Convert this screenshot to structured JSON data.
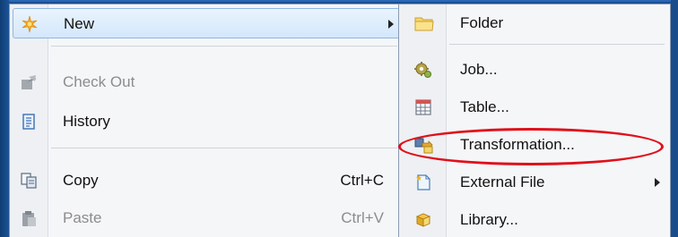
{
  "context_menu": {
    "items": [
      {
        "label": "New",
        "icon": "new-sparkle-icon",
        "submenu": true,
        "highlighted": true
      },
      {
        "label": "Check Out",
        "icon": "check-out-icon",
        "disabled": true
      },
      {
        "label": "History",
        "icon": "history-icon"
      },
      {
        "label": "Copy",
        "icon": "copy-icon",
        "shortcut": "Ctrl+C"
      },
      {
        "label": "Paste",
        "icon": "paste-icon",
        "shortcut": "Ctrl+V",
        "disabled": true
      }
    ]
  },
  "new_submenu": {
    "items": [
      {
        "label": "Folder",
        "icon": "folder-icon"
      },
      {
        "label": "Job...",
        "icon": "job-gear-icon"
      },
      {
        "label": "Table...",
        "icon": "table-icon"
      },
      {
        "label": "Transformation...",
        "icon": "transformation-icon",
        "annotated": true
      },
      {
        "label": "External File",
        "icon": "external-file-icon",
        "submenu": true
      },
      {
        "label": "Library...",
        "icon": "library-icon"
      }
    ]
  },
  "colors": {
    "annotation": "#e0101a",
    "hover": "#d3e7fb",
    "desktop": "#1b4f91"
  }
}
